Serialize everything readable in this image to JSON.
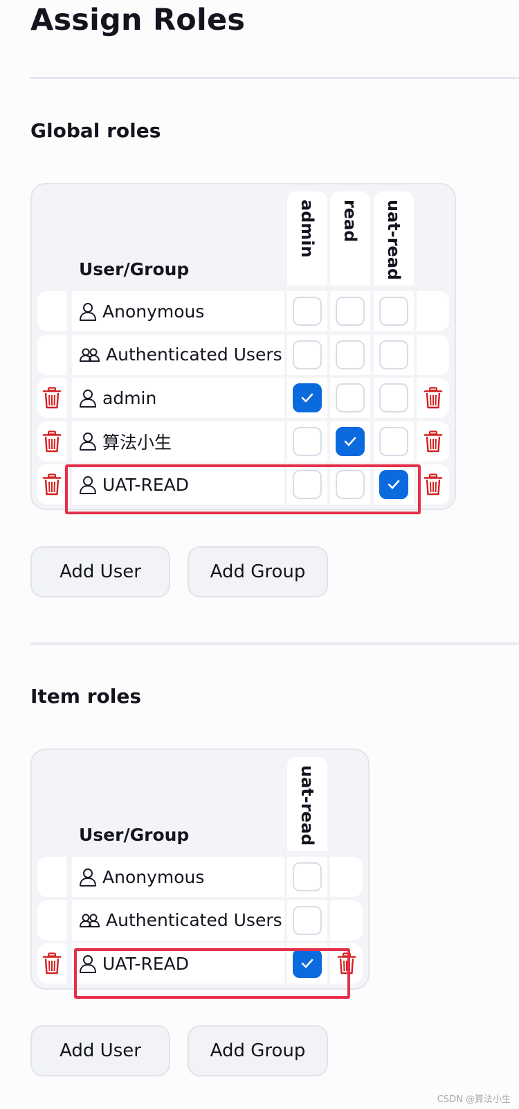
{
  "page": {
    "title": "Assign Roles"
  },
  "global_roles": {
    "title": "Global roles",
    "user_group_header": "User/Group",
    "roles": [
      "admin",
      "read",
      "uat-read"
    ],
    "rows": [
      {
        "name": "Anonymous",
        "type": "user",
        "deletable": false,
        "checks": [
          false,
          false,
          false
        ]
      },
      {
        "name": "Authenticated Users",
        "type": "group",
        "deletable": false,
        "checks": [
          false,
          false,
          false
        ]
      },
      {
        "name": "admin",
        "type": "user",
        "deletable": true,
        "checks": [
          true,
          false,
          false
        ]
      },
      {
        "name": "算法小生",
        "type": "user",
        "deletable": true,
        "checks": [
          false,
          true,
          false
        ]
      },
      {
        "name": "UAT-READ",
        "type": "user",
        "deletable": true,
        "checks": [
          false,
          false,
          true
        ]
      }
    ],
    "add_user_label": "Add User",
    "add_group_label": "Add Group"
  },
  "item_roles": {
    "title": "Item roles",
    "user_group_header": "User/Group",
    "roles": [
      "uat-read"
    ],
    "rows": [
      {
        "name": "Anonymous",
        "type": "user",
        "deletable": false,
        "checks": [
          false
        ]
      },
      {
        "name": "Authenticated Users",
        "type": "group",
        "deletable": false,
        "checks": [
          false
        ]
      },
      {
        "name": "UAT-READ",
        "type": "user",
        "deletable": true,
        "checks": [
          true
        ]
      }
    ],
    "add_user_label": "Add User",
    "add_group_label": "Add Group"
  },
  "colors": {
    "accent": "#0b6bde",
    "danger": "#d42121",
    "highlight": "#e5304a"
  },
  "watermark": "CSDN @算法小生"
}
